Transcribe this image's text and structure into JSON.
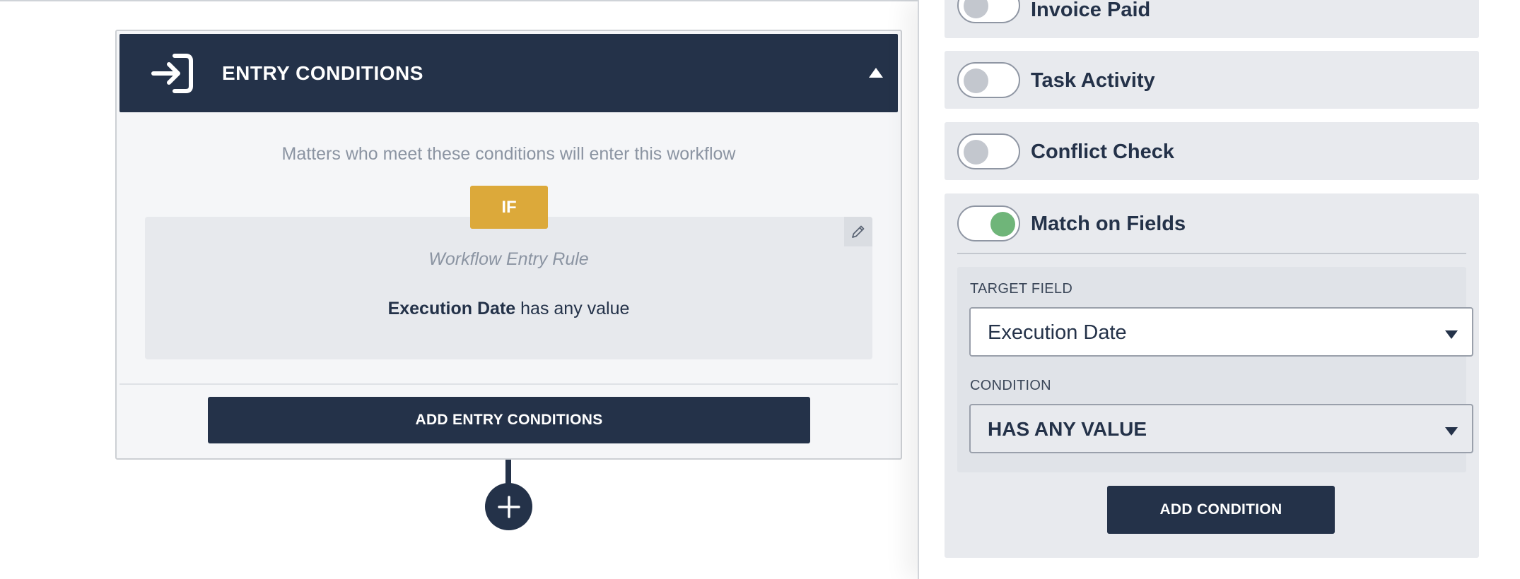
{
  "entry": {
    "title": "ENTRY CONDITIONS",
    "description": "Matters who meet these conditions will enter this workflow",
    "if_label": "IF",
    "rule_name": "Workflow Entry Rule",
    "rule_field": "Execution Date",
    "rule_condition": "has any value",
    "add_button": "ADD ENTRY CONDITIONS"
  },
  "triggers": [
    {
      "label": "Invoice Paid",
      "enabled": false
    },
    {
      "label": "Task Activity",
      "enabled": false
    },
    {
      "label": "Conflict Check",
      "enabled": false
    },
    {
      "label": "Match on Fields",
      "enabled": true
    }
  ],
  "match_fields": {
    "target_field_label": "TARGET FIELD",
    "target_field_value": "Execution Date",
    "condition_label": "CONDITION",
    "condition_value": "HAS ANY VALUE",
    "add_condition_button": "ADD CONDITION"
  },
  "colors": {
    "navy": "#243249",
    "if_badge": "#dca93a",
    "toggle_on": "#6fb579",
    "toggle_off": "#c3c7ce"
  }
}
